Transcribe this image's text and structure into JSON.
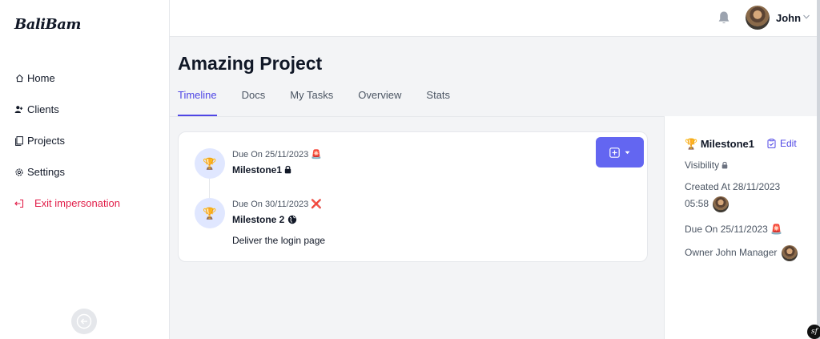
{
  "app": {
    "logo": "BaliBam"
  },
  "sidebar": {
    "items": [
      {
        "label": "Home",
        "icon": "home-icon"
      },
      {
        "label": "Clients",
        "icon": "users-icon"
      },
      {
        "label": "Projects",
        "icon": "document-icon"
      },
      {
        "label": "Settings",
        "icon": "gear-icon"
      }
    ],
    "exit_label": "Exit impersonation"
  },
  "header": {
    "user_name": "John"
  },
  "page": {
    "title": "Amazing Project",
    "tabs": [
      {
        "label": "Timeline",
        "active": true
      },
      {
        "label": "Docs"
      },
      {
        "label": "My Tasks"
      },
      {
        "label": "Overview"
      },
      {
        "label": "Stats"
      }
    ]
  },
  "timeline": {
    "milestones": [
      {
        "due": "Due On 25/11/2023",
        "due_icon": "🚨",
        "title": "Milestone1",
        "title_icon": "lock-icon",
        "description": ""
      },
      {
        "due": "Due On 30/11/2023",
        "due_icon": "❌",
        "title": "Milestone 2",
        "title_icon": "globe-icon",
        "description": "Deliver the login page"
      }
    ]
  },
  "details": {
    "title": "Milestone1",
    "edit_label": "Edit",
    "visibility_label": "Visibility",
    "created_line1": "Created At 28/11/2023",
    "created_line2": "05:58",
    "due": "Due On 25/11/2023",
    "due_icon": "🚨",
    "owner": "Owner John Manager"
  },
  "colors": {
    "accent": "#4f46e5",
    "button": "#6366f1",
    "danger": "#e11d48"
  }
}
